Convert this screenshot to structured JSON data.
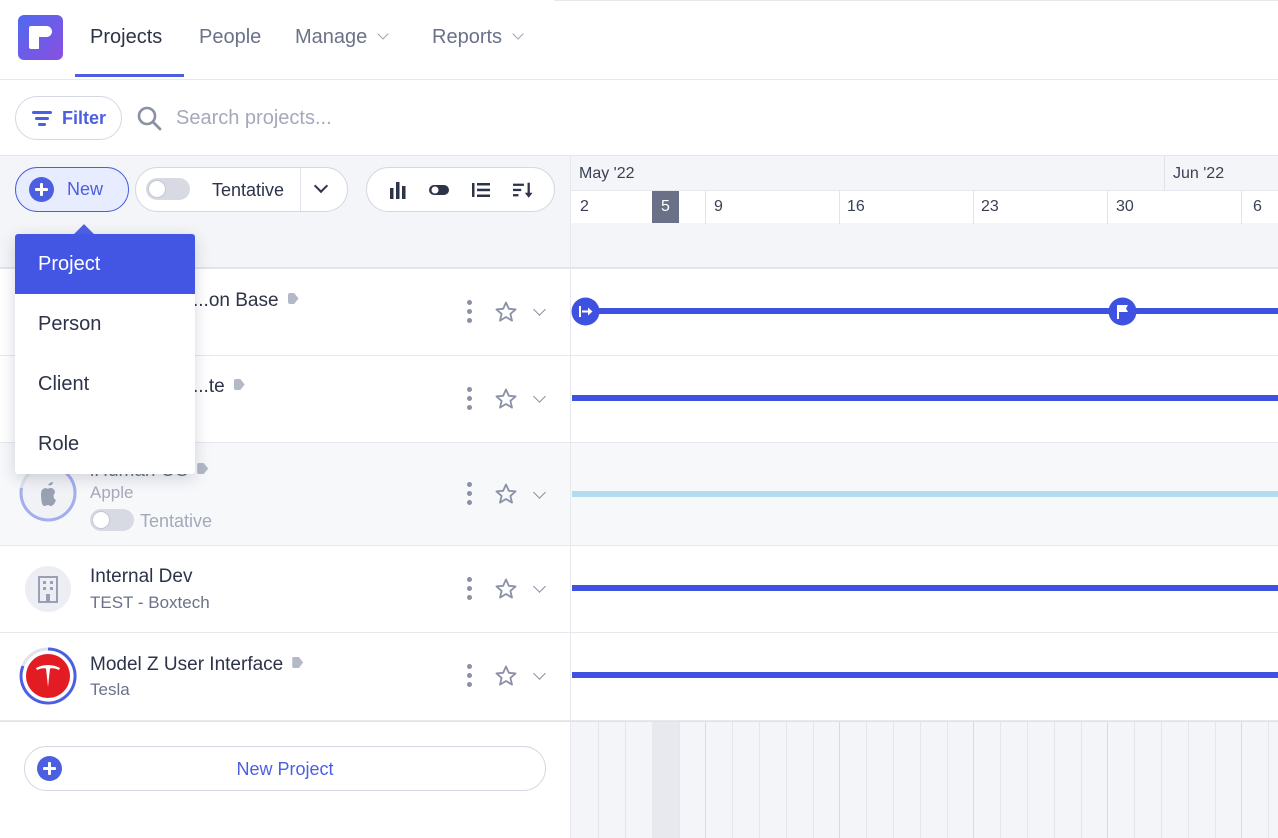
{
  "nav": {
    "items": [
      {
        "label": "Projects",
        "active": true
      },
      {
        "label": "People"
      },
      {
        "label": "Manage"
      },
      {
        "label": "Reports"
      }
    ]
  },
  "filter": {
    "label": "Filter"
  },
  "search": {
    "placeholder": "Search projects..."
  },
  "toolbar": {
    "new_label": "New",
    "tentative_label": "Tentative"
  },
  "new_menu": {
    "items": [
      {
        "label": "Project",
        "active": true
      },
      {
        "label": "Person"
      },
      {
        "label": "Client"
      },
      {
        "label": "Role"
      }
    ]
  },
  "timeline": {
    "months": [
      "May '22",
      "Jun '22"
    ],
    "weeks": [
      "2",
      "5",
      "9",
      "16",
      "23",
      "30",
      "6"
    ],
    "today": "5"
  },
  "projects": [
    {
      "name": "...on Base",
      "client": "",
      "tagged": true
    },
    {
      "name": "...te",
      "client": "",
      "tagged": true
    },
    {
      "name": "iHuman OS",
      "client": "Apple",
      "tentative_label": "Tentative",
      "tentative": true,
      "tagged": true
    },
    {
      "name": "Internal Dev",
      "client": "TEST - Boxtech",
      "tagged": false
    },
    {
      "name": "Model Z User Interface",
      "client": "Tesla",
      "tagged": true
    }
  ],
  "footer": {
    "new_project_label": "New Project"
  },
  "colors": {
    "accent": "#4b5fe0",
    "bar": "#3f51e0",
    "tentative_bar": "#b3dcf1",
    "menu_active": "#4256e3"
  }
}
